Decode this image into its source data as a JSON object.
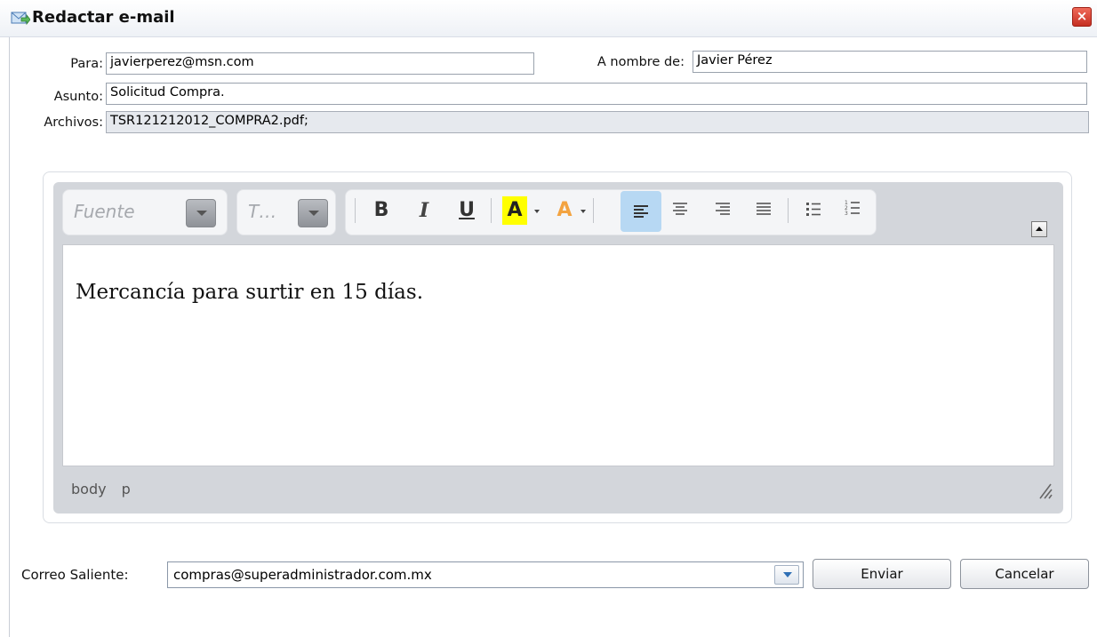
{
  "window": {
    "title": "Redactar e-mail",
    "close_glyph": "×"
  },
  "form": {
    "to_label": "Para:",
    "to_value": "javierperez@msn.com",
    "name_label": "A nombre de:",
    "name_value": "Javier Pérez",
    "subject_label": "Asunto:",
    "subject_value": "Solicitud Compra.",
    "files_label": "Archivos:",
    "files_value": "TSR121212012_COMPRA2.pdf;"
  },
  "editor": {
    "font_combo": "Fuente",
    "size_combo": "T…",
    "bold": "B",
    "italic": "I",
    "underline": "U",
    "text_color": "A",
    "bg_color": "A",
    "content": "Mercancía para surtir en 15 días.",
    "path": [
      "body",
      "p"
    ],
    "icons": {
      "align_left": "align-left-icon",
      "align_center": "align-center-icon",
      "align_right": "align-right-icon",
      "justify": "justify-icon",
      "bullet_list": "bullet-list-icon",
      "numbered_list": "numbered-list-icon"
    }
  },
  "footer": {
    "outgoing_label": "Correo Saliente:",
    "outgoing_value": "compras@superadministrador.com.mx",
    "send_label": "Enviar",
    "cancel_label": "Cancelar"
  },
  "colors": {
    "close_red": "#d43b2d",
    "active_align": "#b7d8f3",
    "text_color_yellow": "#ffff00",
    "bg_color_orange": "#f3a340"
  }
}
